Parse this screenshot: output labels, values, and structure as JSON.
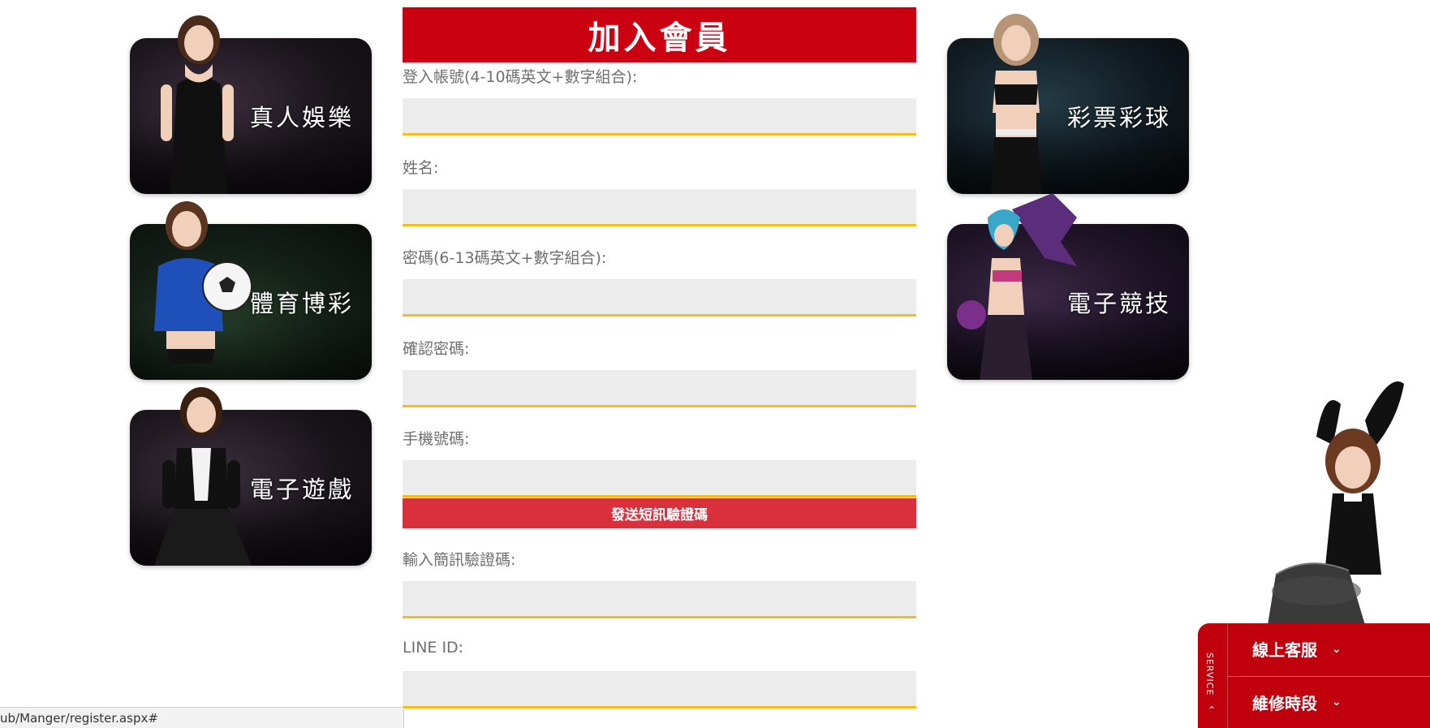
{
  "categories_left": [
    {
      "label": "真人娛樂"
    },
    {
      "label": "體育博彩"
    },
    {
      "label": "電子遊戲"
    }
  ],
  "categories_right": [
    {
      "label": "彩票彩球"
    },
    {
      "label": "電子競技"
    }
  ],
  "form": {
    "title": "加入會員",
    "fields": [
      {
        "label": "登入帳號(4-10碼英文+數字組合):",
        "value": ""
      },
      {
        "label": "姓名:",
        "value": ""
      },
      {
        "label": "密碼(6-13碼英文+數字組合):",
        "value": ""
      },
      {
        "label": "確認密碼:",
        "value": ""
      },
      {
        "label": "手機號碼:",
        "value": ""
      },
      {
        "label": "輸入簡訊驗證碼:",
        "value": ""
      },
      {
        "label": "LINE ID:",
        "value": ""
      }
    ],
    "sms_button_label": "發送短訊驗證碼"
  },
  "service": {
    "tab_label": "SERVICE",
    "items": [
      {
        "label": "線上客服"
      },
      {
        "label": "維修時段"
      }
    ],
    "icons": {
      "chevron": "chevron-down-icon",
      "tab_chevron": "chevron-up-icon"
    },
    "color": "#c1000d"
  },
  "status_bar": {
    "url": "ub/Manger/register.aspx#"
  },
  "colors": {
    "header_red": "#cb0010",
    "button_red": "#d9303c",
    "input_underline": "#f4bd1b",
    "input_bg": "#ececec"
  }
}
